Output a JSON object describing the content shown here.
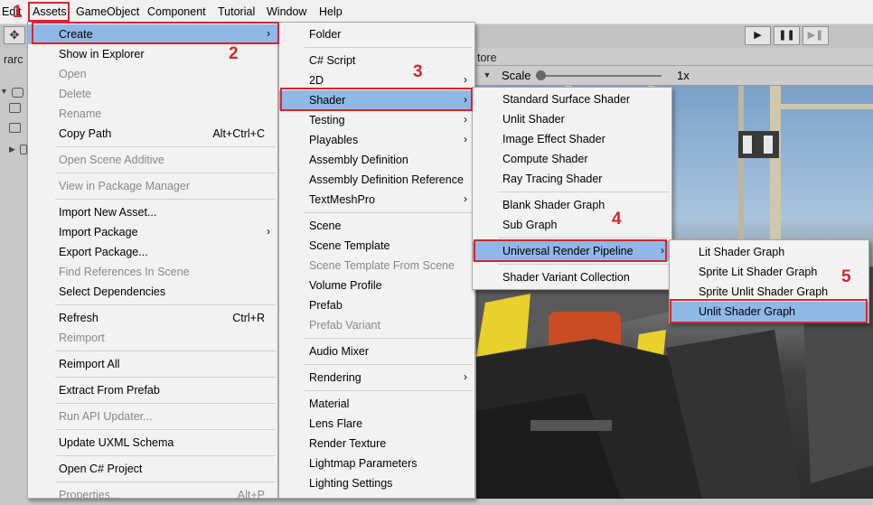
{
  "menubar": {
    "items": [
      "Edit",
      "Assets",
      "GameObject",
      "Component",
      "Tutorial",
      "Window",
      "Help"
    ]
  },
  "hierarchy": {
    "title": "rarc"
  },
  "scene": {
    "tab_label": "tore",
    "scale_label": "Scale",
    "scale_value": "1x"
  },
  "steps": [
    "1",
    "2",
    "3",
    "4",
    "5"
  ],
  "menus": {
    "assets": [
      {
        "label": "Create",
        "submenu": true,
        "highlighted": true
      },
      {
        "label": "Show in Explorer"
      },
      {
        "label": "Open",
        "disabled": true
      },
      {
        "label": "Delete",
        "disabled": true
      },
      {
        "label": "Rename",
        "disabled": true
      },
      {
        "label": "Copy Path",
        "shortcut": "Alt+Ctrl+C"
      },
      {
        "label": "Open Scene Additive",
        "disabled": true
      },
      {
        "label": "View in Package Manager",
        "disabled": true
      },
      {
        "label": "Import New Asset..."
      },
      {
        "label": "Import Package",
        "submenu": true
      },
      {
        "label": "Export Package..."
      },
      {
        "label": "Find References In Scene",
        "disabled": true
      },
      {
        "label": "Select Dependencies"
      },
      {
        "label": "Refresh",
        "shortcut": "Ctrl+R"
      },
      {
        "label": "Reimport",
        "disabled": true
      },
      {
        "label": "Reimport All"
      },
      {
        "label": "Extract From Prefab"
      },
      {
        "label": "Run API Updater...",
        "disabled": true
      },
      {
        "label": "Update UXML Schema"
      },
      {
        "label": "Open C# Project"
      },
      {
        "label": "Properties...",
        "shortcut": "Alt+P",
        "disabled": true
      }
    ],
    "create": [
      {
        "label": "Folder"
      },
      {
        "label": "C# Script"
      },
      {
        "label": "2D",
        "submenu": true
      },
      {
        "label": "Shader",
        "submenu": true,
        "highlighted": true
      },
      {
        "label": "Testing",
        "submenu": true
      },
      {
        "label": "Playables",
        "submenu": true
      },
      {
        "label": "Assembly Definition"
      },
      {
        "label": "Assembly Definition Reference"
      },
      {
        "label": "TextMeshPro",
        "submenu": true
      },
      {
        "label": "Scene"
      },
      {
        "label": "Scene Template"
      },
      {
        "label": "Scene Template From Scene",
        "disabled": true
      },
      {
        "label": "Volume Profile"
      },
      {
        "label": "Prefab"
      },
      {
        "label": "Prefab Variant",
        "disabled": true
      },
      {
        "label": "Audio Mixer"
      },
      {
        "label": "Rendering",
        "submenu": true
      },
      {
        "label": "Material"
      },
      {
        "label": "Lens Flare"
      },
      {
        "label": "Render Texture"
      },
      {
        "label": "Lightmap Parameters"
      },
      {
        "label": "Lighting Settings"
      }
    ],
    "shader": [
      {
        "label": "Standard Surface Shader"
      },
      {
        "label": "Unlit Shader"
      },
      {
        "label": "Image Effect Shader"
      },
      {
        "label": "Compute Shader"
      },
      {
        "label": "Ray Tracing Shader"
      },
      {
        "label": "Blank Shader Graph"
      },
      {
        "label": "Sub Graph"
      },
      {
        "label": "Universal Render Pipeline",
        "submenu": true,
        "highlighted": true
      },
      {
        "label": "Shader Variant Collection"
      }
    ],
    "urp": [
      {
        "label": "Lit Shader Graph"
      },
      {
        "label": "Sprite Lit Shader Graph"
      },
      {
        "label": "Sprite Unlit Shader Graph"
      },
      {
        "label": "Unlit Shader Graph",
        "highlighted": true
      }
    ]
  }
}
